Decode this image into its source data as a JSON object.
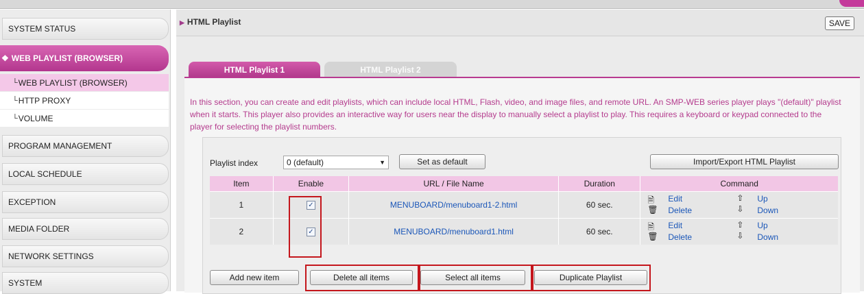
{
  "sidebar": {
    "items": [
      {
        "label": "SYSTEM STATUS"
      },
      {
        "label": "WEB PLAYLIST (BROWSER)"
      },
      {
        "label": "PROGRAM MANAGEMENT"
      },
      {
        "label": "LOCAL SCHEDULE"
      },
      {
        "label": "EXCEPTION"
      },
      {
        "label": "MEDIA FOLDER"
      },
      {
        "label": "NETWORK SETTINGS"
      },
      {
        "label": "SYSTEM"
      }
    ],
    "sub_items": [
      {
        "label": "WEB PLAYLIST (BROWSER)"
      },
      {
        "label": "HTTP PROXY"
      },
      {
        "label": "VOLUME"
      }
    ]
  },
  "header": {
    "title": "HTML Playlist",
    "save_label": "SAVE"
  },
  "tabs": [
    {
      "label": "HTML Playlist 1"
    },
    {
      "label": "HTML Playlist 2"
    }
  ],
  "description": "In this section, you can create and edit playlists, which can include local HTML, Flash, video, and image files, and remote URL. An SMP-WEB series player plays \"(default)\" playlist when it starts. This player also provides an interactive way for users near the display to manually select a playlist to play. This requires a keyboard or keypad connected to the player for selecting the playlist numbers.",
  "playlist": {
    "index_label": "Playlist index",
    "index_value": "0 (default)",
    "set_default_label": "Set as default",
    "import_export_label": "Import/Export HTML Playlist"
  },
  "table": {
    "headers": [
      "Item",
      "Enable",
      "URL / File Name",
      "Duration",
      "Command"
    ],
    "rows": [
      {
        "item": "1",
        "enabled": true,
        "url": "MENUBOARD/menuboard1-2.html",
        "duration": "60 sec.",
        "edit": "Edit",
        "delete": "Delete",
        "up": "Up",
        "down": "Down"
      },
      {
        "item": "2",
        "enabled": true,
        "url": "MENUBOARD/menuboard1.html",
        "duration": "60 sec.",
        "edit": "Edit",
        "delete": "Delete",
        "up": "Up",
        "down": "Down"
      }
    ]
  },
  "actions": {
    "add": "Add new item",
    "delete_all": "Delete all items",
    "select_all": "Select all items",
    "duplicate": "Duplicate Playlist"
  },
  "colors": {
    "accent": "#b83a90",
    "link": "#1a56b8",
    "highlight": "#c4161c"
  }
}
